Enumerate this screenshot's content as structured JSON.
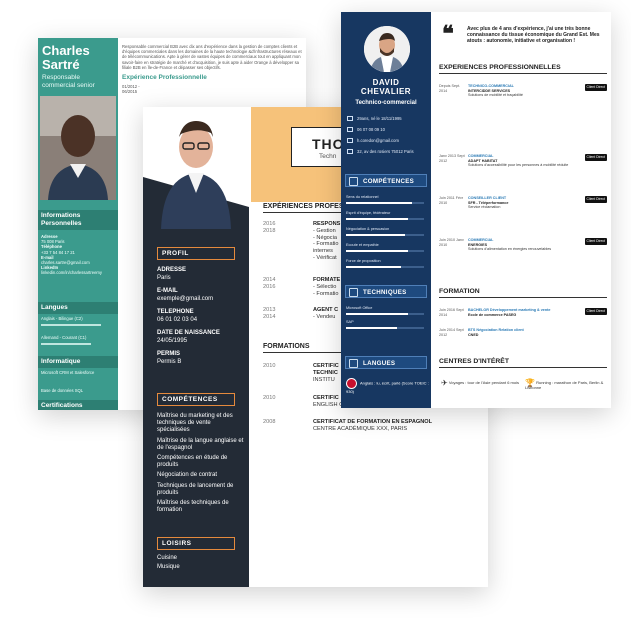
{
  "back_cv": {
    "name": "Charles Sartré",
    "role": "Responsable commercial senior",
    "sections": {
      "info": "Informations Personnelles",
      "langues": "Langues",
      "informatique": "Informatique",
      "certifications": "Certifications"
    },
    "info_items": [
      {
        "label": "Adresse",
        "value": "75 008 Paris"
      },
      {
        "label": "Téléphone",
        "value": "+33 7 54 84 17 21"
      },
      {
        "label": "E-mail",
        "value": "charles.sartre@gmail.com"
      },
      {
        "label": "LinkedIn",
        "value": "linkedin.com/in/charlessartreemy"
      }
    ],
    "langues_items": [
      "Anglais - Bilingue (C2)",
      "Allemand - Courant (C1)"
    ],
    "informatique_items": [
      "Microsoft CRM et Salesforce",
      "Base de données SQL"
    ],
    "cert_items": [
      "10/2014 Certification ABOR en Performance collective",
      "10/2014 Certification ABOR en Relation client et écoute"
    ],
    "intro": "Responsable commercial B2B avec dix ans d'expérience dans la gestion de comptes clients et d'équipes commerciales dans les domaines de la haute technologie &d'infrastructures réseaux et de télécommunications. Apte à gérer de vastes équipes de commerciaux tout en appliquant mon savoir-faire en stratégie de marché et d'acquisition, je suis apte à aider Orange à développer sa filiale B2B en Île-de-France et dépasser ses objectifs.",
    "exp_title": "Expérience Professionnelle",
    "dates": [
      "01/2012 -",
      "06/2015",
      "06/2009 -",
      "12/2011",
      "06/2009 -",
      "06/2009"
    ],
    "other_heads": [
      "Forma",
      "Compé"
    ]
  },
  "mid_cv": {
    "title": "THO",
    "subtitle": "Techn",
    "side": {
      "profil": "PROFIL",
      "fields": [
        {
          "label": "ADRESSE",
          "value": "Paris"
        },
        {
          "label": "E-MAIL",
          "value": "exemple@gmail.com"
        },
        {
          "label": "TELEPHONE",
          "value": "06 01 02 03 04"
        },
        {
          "label": "DATE DE NAISSANCE",
          "value": "24/05/1995"
        },
        {
          "label": "PERMIS",
          "value": "Permis B"
        }
      ],
      "competences": "COMPÉTENCES",
      "competences_items": [
        "Maîtrise du marketing et des techniques de vente spécialisées",
        "Maîtrise de la langue anglaise et de l'espagnol",
        "Compétences en étude de produits",
        "Négociation de contrat",
        "Techniques de lancement de produits",
        "Maîtrise des techniques de formation"
      ],
      "loisirs": "LOISIRS",
      "loisirs_items": [
        "Cuisine",
        "Musique"
      ]
    },
    "experiences_title": "EXPÉRIENCES PROFESS",
    "experiences": [
      {
        "years": [
          "2016",
          "2018"
        ],
        "lines": [
          "RESPONS",
          "- Gestion",
          "- Négocia",
          "- Formatio",
          "internes",
          "- Vérificat"
        ]
      },
      {
        "years": [
          "2014",
          "2016"
        ],
        "lines": [
          "FORMATE",
          "- Sélectio",
          "- Formatio"
        ]
      },
      {
        "years": [
          "2013",
          "2014"
        ],
        "lines": [
          "AGENT C",
          "- Vendeu"
        ]
      }
    ],
    "formations_title": "FORMATIONS",
    "formations": [
      {
        "year": "2010",
        "title": "CERTIFIC",
        "sub": "TECHNIC",
        "inst": "INSTITU"
      },
      {
        "year": "2010",
        "title": "CERTIFIC",
        "sub": "",
        "inst": "ENGLISH C"
      },
      {
        "year": "2008",
        "title": "CERTIFICAT DE FORMATION EN ESPAGNOL",
        "sub": "",
        "inst": "CENTRE ACADÉMIQUE XXX, PARIS"
      }
    ]
  },
  "front_cv": {
    "first_name": "DAVID",
    "last_name": "CHEVALIER",
    "role": "Technico-commercial",
    "contacts": [
      "29ans, né le 18/11/1995",
      "06 07 08 09 10",
      "h.coredon@gmail.com",
      "32, av des rosiers 75012 Paris"
    ],
    "sections": {
      "competences": "COMPÉTENCES",
      "techniques": "TECHNIQUES",
      "langues": "LANGUES",
      "experiences": "EXPERIENCES PROFESSIONNELLES",
      "formation": "FORMATION",
      "interets": "CENTRES D'INTÉRÊT"
    },
    "skills": [
      {
        "name": "Sens du relationnel",
        "level": 0.85
      },
      {
        "name": "Esprit d'équipe, fédérateur",
        "level": 0.8
      },
      {
        "name": "Négociation & persuasion",
        "level": 0.75
      },
      {
        "name": "Ecoute et empathie",
        "level": 0.8
      },
      {
        "name": "Force de proposition",
        "level": 0.7
      }
    ],
    "tech": [
      {
        "name": "Microsoft Office",
        "level": 0.8
      },
      {
        "name": "SAP",
        "level": 0.65
      }
    ],
    "language": "Anglais : lu, écrit, parlé (Score TOEIC : 930)",
    "quote": "Avec plus de 4 ans d'expérience, j'ai une très bonne connaissance du tissue économique du Grand Est. Mes atouts : autonomie, initiative et organisation !",
    "experiences": [
      {
        "dates": "Depuis Sept. 2014",
        "title": "TECHNICO-COMMERCIAL",
        "company": "INTERCIDDE SERVICES",
        "desc": "Solutions de mobilité et traçabilité",
        "badge": "Client Direct"
      },
      {
        "dates": "Janv 2013 Sept 2012",
        "title": "COMMERCIAL",
        "company": "ADAPT HABITAT",
        "desc": "Solutions d'accessibilité pour les personnes à mobilité réduite",
        "badge": "Client Direct"
      },
      {
        "dates": "Juin 2011 Févr 2010",
        "title": "CONSEILLER CLIENT",
        "company": "SFR - Téléperformance",
        "desc": "Service réclamation",
        "badge": "Client Direct"
      },
      {
        "dates": "Juin 2010 Janv 2010",
        "title": "COMMERCIAL",
        "company": "ENERGIES",
        "desc": "Solutions d'alimentation en énergies renouvelables",
        "badge": "Client Direct"
      }
    ],
    "formations": [
      {
        "dates": "Juin 2016 Sept 2014",
        "title": "BACHELOR Développement marketing & vente",
        "school": "Ecole de commerce PASEG",
        "badge": "Client Direct"
      },
      {
        "dates": "Juin 2014 Sept 2012",
        "title": "BTS Négociation Relation client",
        "school": "CNED",
        "badge": ""
      }
    ],
    "interets": [
      {
        "icon": "airplane-icon",
        "text": "Voyages : tour de l'Asie pendant 6 mois"
      },
      {
        "icon": "trophy-icon",
        "text": "Running : marathon de Paris, Berlin & Lisbonne"
      }
    ]
  }
}
